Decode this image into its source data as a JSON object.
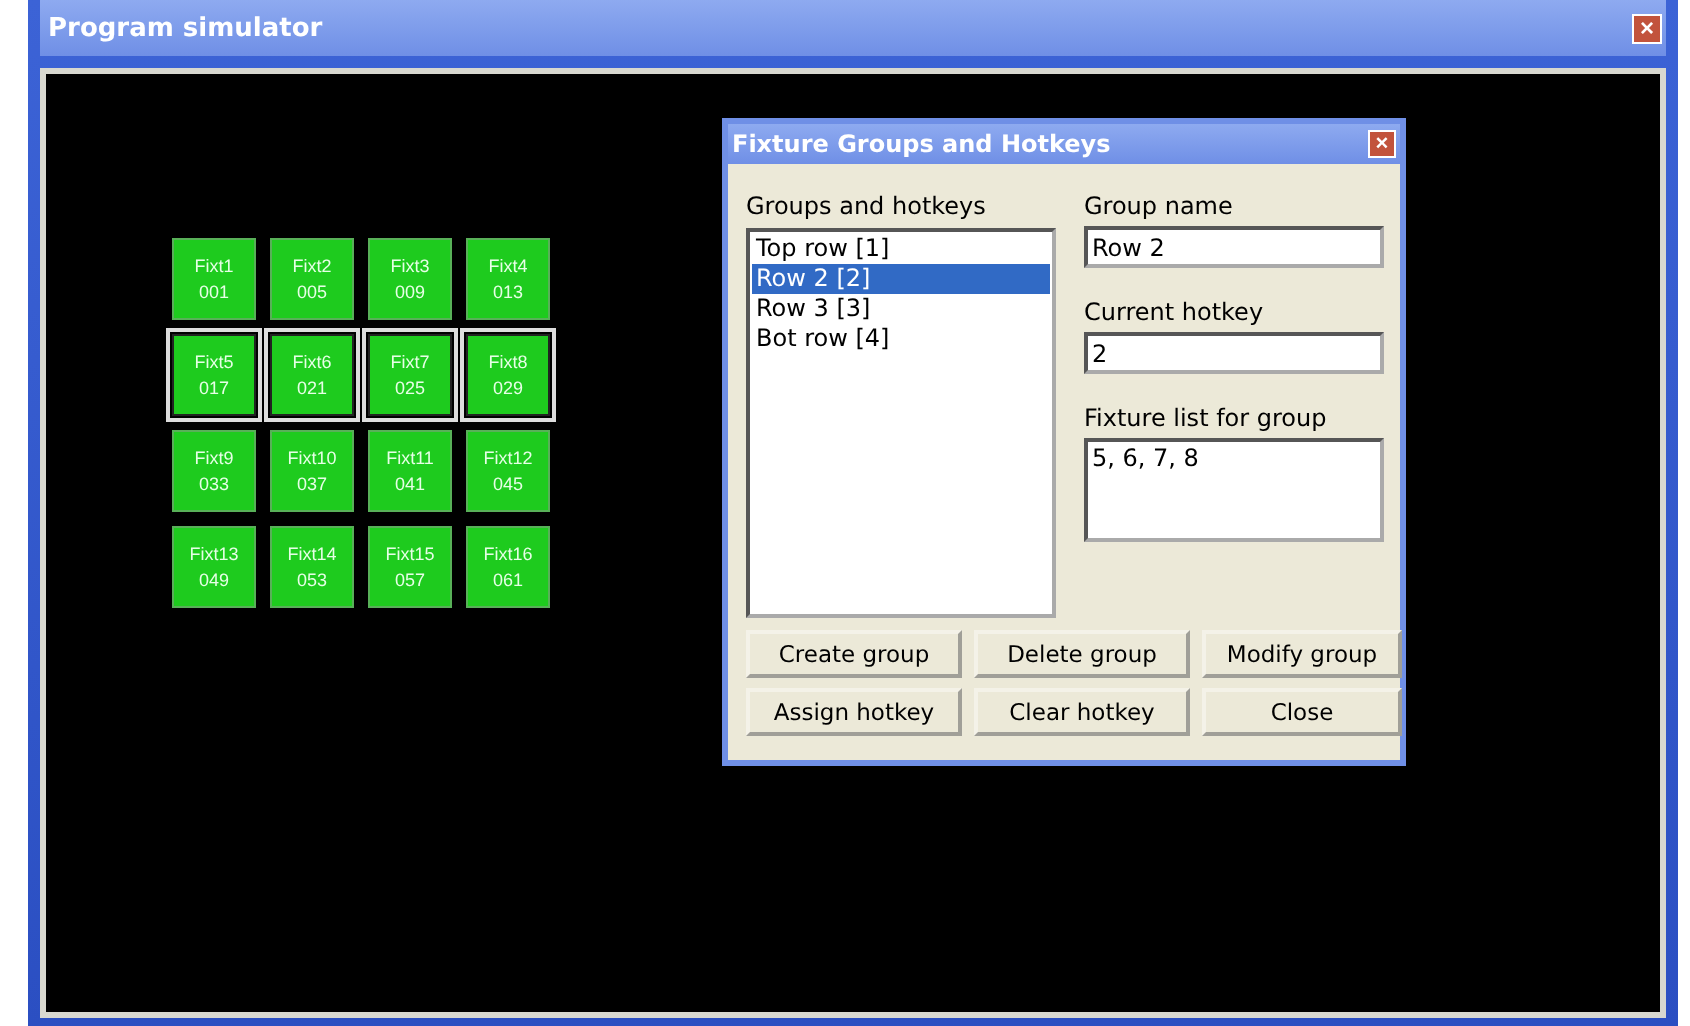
{
  "window": {
    "title": "Program simulator",
    "close": "×"
  },
  "fixtures": [
    {
      "name": "Fixt1",
      "address": "001",
      "selected": false
    },
    {
      "name": "Fixt2",
      "address": "005",
      "selected": false
    },
    {
      "name": "Fixt3",
      "address": "009",
      "selected": false
    },
    {
      "name": "Fixt4",
      "address": "013",
      "selected": false
    },
    {
      "name": "Fixt5",
      "address": "017",
      "selected": true
    },
    {
      "name": "Fixt6",
      "address": "021",
      "selected": true
    },
    {
      "name": "Fixt7",
      "address": "025",
      "selected": true
    },
    {
      "name": "Fixt8",
      "address": "029",
      "selected": true
    },
    {
      "name": "Fixt9",
      "address": "033",
      "selected": false
    },
    {
      "name": "Fixt10",
      "address": "037",
      "selected": false
    },
    {
      "name": "Fixt11",
      "address": "041",
      "selected": false
    },
    {
      "name": "Fixt12",
      "address": "045",
      "selected": false
    },
    {
      "name": "Fixt13",
      "address": "049",
      "selected": false
    },
    {
      "name": "Fixt14",
      "address": "053",
      "selected": false
    },
    {
      "name": "Fixt15",
      "address": "057",
      "selected": false
    },
    {
      "name": "Fixt16",
      "address": "061",
      "selected": false
    }
  ],
  "dialog": {
    "title": "Fixture Groups and Hotkeys",
    "close": "×",
    "groups_label": "Groups and hotkeys",
    "groups": [
      {
        "label": "Top row [1]",
        "selected": false
      },
      {
        "label": "Row 2 [2]",
        "selected": true
      },
      {
        "label": "Row 3 [3]",
        "selected": false
      },
      {
        "label": "Bot row [4]",
        "selected": false
      }
    ],
    "group_name": {
      "label": "Group name",
      "value": "Row 2"
    },
    "current_hotkey": {
      "label": "Current hotkey",
      "value": "2"
    },
    "fixture_list": {
      "label": "Fixture list for group",
      "value": "5, 6, 7, 8"
    },
    "buttons": [
      "Create group",
      "Delete group",
      "Modify group",
      "Assign hotkey",
      "Clear hotkey",
      "Close"
    ]
  }
}
